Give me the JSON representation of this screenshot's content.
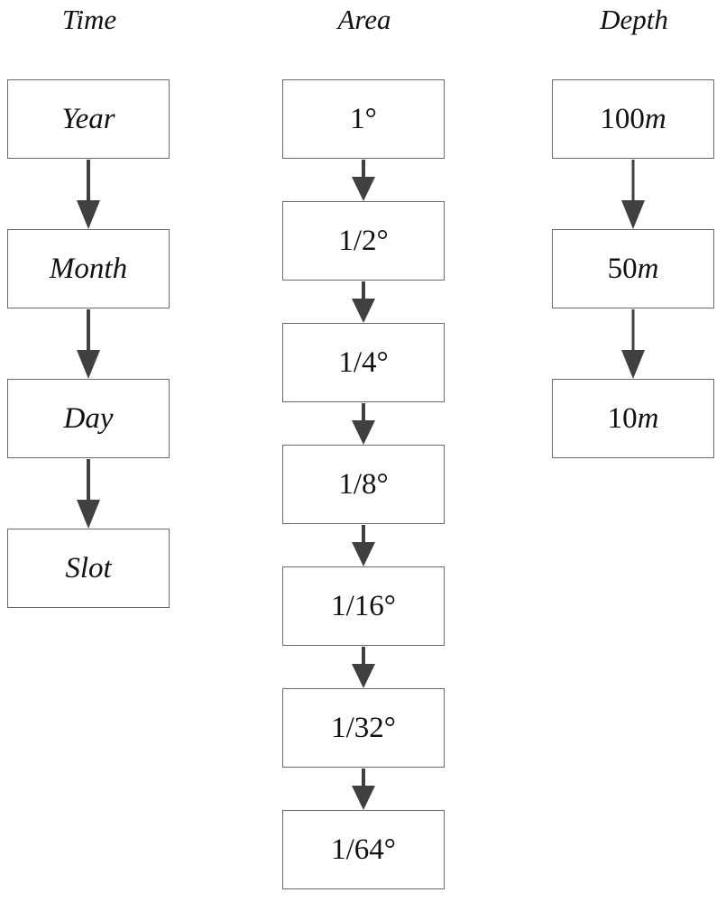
{
  "diagram": {
    "columns": [
      {
        "id": "time",
        "title": "Time",
        "italic_labels": true,
        "nodes": [
          {
            "label": "Year"
          },
          {
            "label": "Month"
          },
          {
            "label": "Day"
          },
          {
            "label": "Slot"
          }
        ]
      },
      {
        "id": "area",
        "title": "Area",
        "italic_labels": false,
        "nodes": [
          {
            "label": "1°"
          },
          {
            "label": "1/2°"
          },
          {
            "label": "1/4°"
          },
          {
            "label": "1/8°"
          },
          {
            "label": "1/16°"
          },
          {
            "label": "1/32°"
          },
          {
            "label": "1/64°"
          }
        ]
      },
      {
        "id": "depth",
        "title": "Depth",
        "italic_labels": false,
        "nodes": [
          {
            "label": "100",
            "unit": "m"
          },
          {
            "label": "50",
            "unit": "m"
          },
          {
            "label": "10",
            "unit": "m"
          }
        ]
      }
    ],
    "edges": [
      {
        "column": "time",
        "from": "Year",
        "to": "Month"
      },
      {
        "column": "time",
        "from": "Month",
        "to": "Day"
      },
      {
        "column": "time",
        "from": "Day",
        "to": "Slot"
      },
      {
        "column": "area",
        "from": "1°",
        "to": "1/2°"
      },
      {
        "column": "area",
        "from": "1/2°",
        "to": "1/4°"
      },
      {
        "column": "area",
        "from": "1/4°",
        "to": "1/8°"
      },
      {
        "column": "area",
        "from": "1/8°",
        "to": "1/16°"
      },
      {
        "column": "area",
        "from": "1/16°",
        "to": "1/32°"
      },
      {
        "column": "area",
        "from": "1/32°",
        "to": "1/64°"
      },
      {
        "column": "depth",
        "from": "100m",
        "to": "50m"
      },
      {
        "column": "depth",
        "from": "50m",
        "to": "10m"
      }
    ],
    "colors": {
      "box_border": "#6b6b6b",
      "arrow": "#404040",
      "text": "#111111"
    }
  }
}
